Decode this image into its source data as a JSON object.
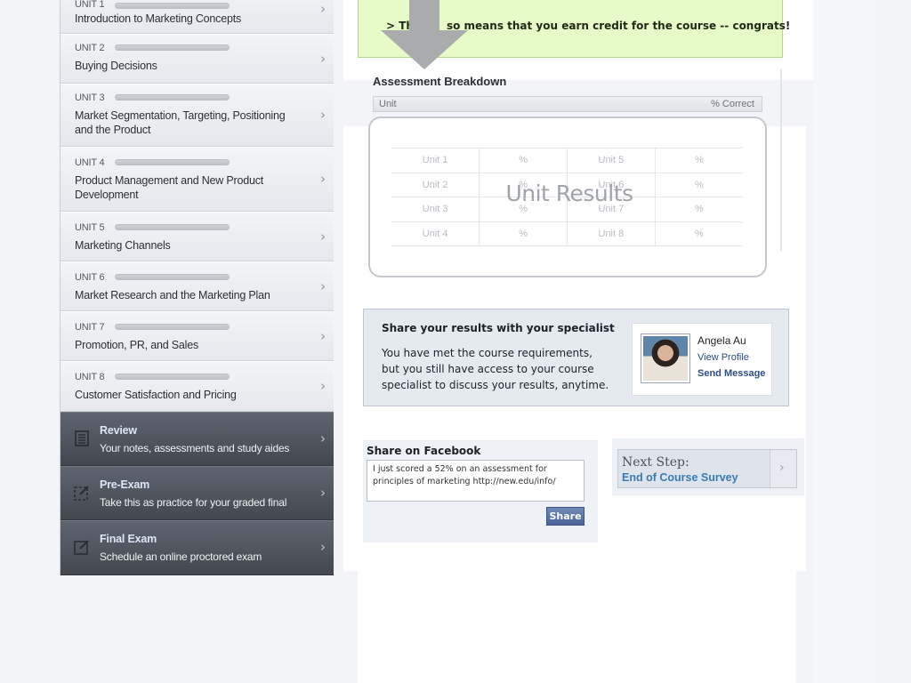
{
  "units": [
    {
      "tag": "UNIT 1",
      "title": "Introduction to Marketing Concepts"
    },
    {
      "tag": "UNIT 2",
      "title": "Buying Decisions"
    },
    {
      "tag": "UNIT 3",
      "title": "Market Segmentation, Targeting, Positioning and the Product"
    },
    {
      "tag": "UNIT 4",
      "title": "Product Management and New Product Development"
    },
    {
      "tag": "UNIT 5",
      "title": "Marketing Channels"
    },
    {
      "tag": "UNIT 6",
      "title": "Market Research and the Marketing Plan"
    },
    {
      "tag": "UNIT 7",
      "title": "Promotion, PR, and Sales"
    },
    {
      "tag": "UNIT 8",
      "title": "Customer Satisfaction and Pricing"
    }
  ],
  "actions": [
    {
      "title": "Review",
      "subtitle": "Your notes, assessments and study aides",
      "icon": "notes-icon"
    },
    {
      "title": "Pre-Exam",
      "subtitle": "Take this as practice for your graded final",
      "icon": "dashed-edit-icon"
    },
    {
      "title": "Final Exam",
      "subtitle": "Schedule an online proctored exam",
      "icon": "edit-icon"
    }
  ],
  "banner": {
    "text_left": "> Th",
    "text_right": "so means that you earn credit for the course --  congrats!"
  },
  "assessment": {
    "title": "Assessment Breakdown",
    "col_unit": "Unit",
    "col_correct": "% Correct",
    "overlay": "Unit Results",
    "rows": [
      [
        "Unit 1",
        "%",
        "Unit 5",
        "%"
      ],
      [
        "Unit 2",
        "%",
        "Unit 6",
        "%"
      ],
      [
        "Unit 3",
        "%",
        "Unit 7",
        "%"
      ],
      [
        "Unit 4",
        "%",
        "Unit 8",
        "%"
      ]
    ]
  },
  "specialist": {
    "title": "Share your results with your specialist",
    "body": "You have met the course requirements, but you still have access to your course specialist to discuss your results, anytime.",
    "name": "Angela Au",
    "view_profile": "View Profile",
    "send_message": "Send Message"
  },
  "facebook": {
    "title": "Share on Facebook",
    "message": "I just scored a 52% on an assessment for principles of marketing http://new.edu/info/",
    "share_label": "Share"
  },
  "next_step": {
    "label": "Next Step:",
    "link": "End of Course Survey"
  },
  "colors": {
    "banner_bg": "#e6fbc8",
    "dark_nav": "#4b5058",
    "link_blue": "#3a7bb2",
    "fb_blue": "#4b659a"
  }
}
